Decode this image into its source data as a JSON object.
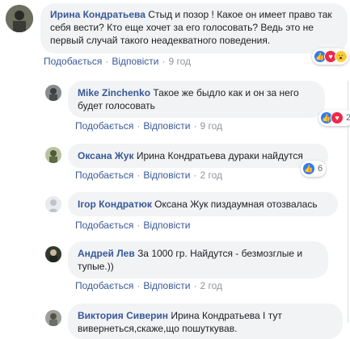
{
  "actions": {
    "like": "Подобається",
    "reply": "Відповісти",
    "sep": "·"
  },
  "comments": [
    {
      "name": "Ирина Кондратьева",
      "text": "Стыд и позор ! Какое он имеет право так себя вести? Кто еще хочет за его голосовать? Ведь это не первый случай такого неадекватного поведения.",
      "time": "9 год",
      "reactions": [
        "like-icon",
        "love-icon",
        "wow-icon"
      ],
      "reaction_count": ""
    },
    {
      "name": "Mike Zinchenko",
      "text": "Такое же быдло как и он за него будет голосовать",
      "time": "9 год",
      "reactions": [
        "like-icon",
        "love-icon"
      ],
      "reaction_count": "2"
    },
    {
      "name": "Оксана Жук",
      "text": "Ирина Кондратьева дураки найдутся",
      "time": "2 год",
      "reactions": [
        "like-icon"
      ],
      "reaction_count": "6"
    },
    {
      "name": "Ігор Кондратюк",
      "text": "Оксана Жук пиздаумная отозвалась",
      "time": "",
      "reactions": [],
      "reaction_count": ""
    },
    {
      "name": "Андрей Лев",
      "text": "За 1000 гр. Найдутся - безмозглые и тупые.))",
      "time": "2 год",
      "reactions": [],
      "reaction_count": ""
    },
    {
      "name": "Виктория Сиверин",
      "text": "Ирина Кондратьева І тут вивернеться,скаже,що пошуткував.",
      "time": "",
      "reactions": [],
      "reaction_count": ""
    }
  ],
  "colors": {
    "link": "#385898",
    "bubble": "#f2f3f5",
    "meta": "#90949c",
    "like": "#2e7cf6",
    "love": "#f0284a",
    "wow": "#fbd04a"
  }
}
